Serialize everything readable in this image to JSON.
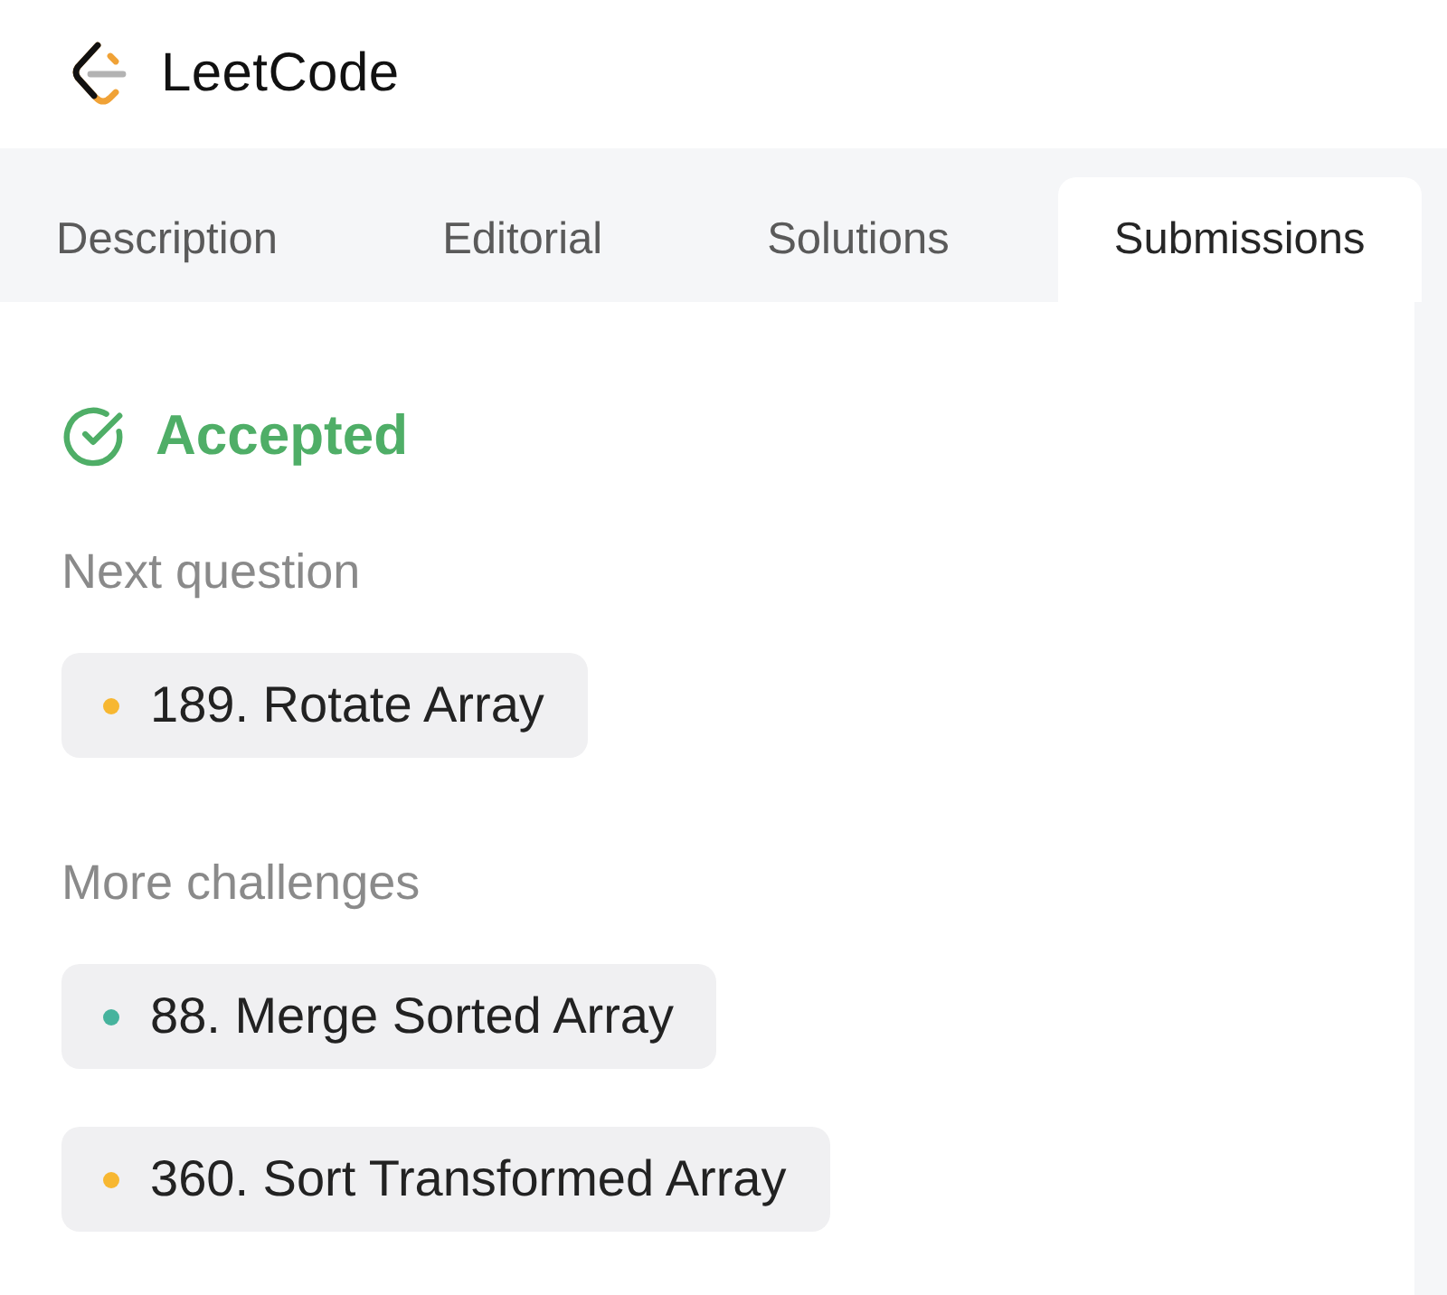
{
  "logo": {
    "text": "LeetCode"
  },
  "tabs": [
    {
      "label": "Description",
      "selected": false
    },
    {
      "label": "Editorial",
      "selected": false
    },
    {
      "label": "Solutions",
      "selected": false
    },
    {
      "label": "Submissions",
      "selected": true
    }
  ],
  "result": {
    "kind": "accepted",
    "status": "Accepted"
  },
  "next_question": {
    "heading": "Next question",
    "items": [
      {
        "title": "189. Rotate Array",
        "color": "#f7b731"
      }
    ]
  },
  "more_challenges": {
    "heading": "More challenges",
    "items": [
      {
        "title": "88. Merge Sorted Array",
        "color": "#46b39d"
      },
      {
        "title": "360. Sort Transformed Array",
        "color": "#f7b731"
      }
    ]
  }
}
